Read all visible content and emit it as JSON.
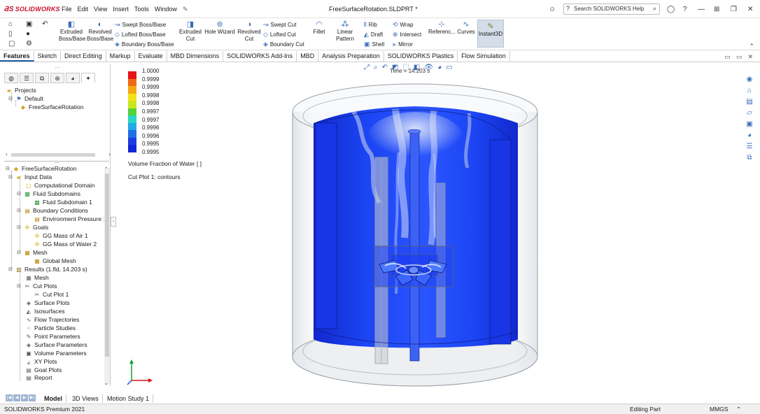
{
  "app": {
    "brand": "SOLIDWORKS",
    "document_title": "FreeSurfaceRotation.SLDPRT *",
    "search_placeholder": "Search SOLIDWORKS Help"
  },
  "menu": [
    "File",
    "Edit",
    "View",
    "Insert",
    "Tools",
    "Window"
  ],
  "commands": {
    "extruded_boss": [
      "Extruded",
      "Boss/Base"
    ],
    "revolved_boss": [
      "Revolved",
      "Boss/Base"
    ],
    "swept_boss": "Swept Boss/Base",
    "lofted_boss": "Lofted Boss/Base",
    "boundary_boss": "Boundary Boss/Base",
    "extruded_cut": [
      "Extruded",
      "Cut"
    ],
    "hole_wizard": "Hole Wizard",
    "revolved_cut": [
      "Revolved",
      "Cut"
    ],
    "swept_cut": "Swept Cut",
    "lofted_cut": "Lofted Cut",
    "boundary_cut": "Boundary Cut",
    "fillet": "Fillet",
    "linear_pattern": "Linear Pattern",
    "rib": "Rib",
    "draft": "Draft",
    "shell": "Shell",
    "wrap": "Wrap",
    "intersect": "Intersect",
    "mirror": "Mirror",
    "reference": "Referenc...",
    "curves": "Curves",
    "instant3d": "Instant3D"
  },
  "tabs": [
    "Features",
    "Sketch",
    "Direct Editing",
    "Markup",
    "Evaluate",
    "MBD Dimensions",
    "SOLIDWORKS Add-Ins",
    "MBD",
    "Analysis Preparation",
    "SOLIDWORKS Plastics",
    "Flow Simulation"
  ],
  "active_tab": "Features",
  "top_tree": {
    "projects": "Projects",
    "default": "Default",
    "part": "FreeSurfaceRotation"
  },
  "analysis_tree": {
    "root": "FreeSurfaceRotation",
    "input_data": "Input Data",
    "computational_domain": "Computational Domain",
    "fluid_subdomains": "Fluid Subdomains",
    "fluid_subdomain_1": "Fluid Subdomain 1",
    "boundary_conditions": "Boundary Conditions",
    "environment_pressure": "Environment Pressure 1",
    "goals": "Goals",
    "goal_air": "GG Mass of Air 1",
    "goal_water": "GG Mass of Water 2",
    "mesh": "Mesh",
    "global_mesh": "Global Mesh",
    "results": "Results (1.fld, 14.203 s)",
    "results_mesh": "Mesh",
    "cut_plots": "Cut Plots",
    "cut_plot_1": "Cut Plot 1",
    "surface_plots": "Surface Plots",
    "isosurfaces": "Isosurfaces",
    "flow_trajectories": "Flow Trajectories",
    "particle_studies": "Particle Studies",
    "point_parameters": "Point Parameters",
    "surface_parameters": "Surface Parameters",
    "volume_parameters": "Volume Parameters",
    "xy_plots": "XY Plots",
    "goal_plots": "Goal Plots",
    "report": "Report"
  },
  "legend": {
    "values": [
      "1.0000",
      "0.9999",
      "0.9999",
      "0.9998",
      "0.9998",
      "0.9997",
      "0.9997",
      "0.9996",
      "0.9996",
      "0.9995",
      "0.9995"
    ],
    "colors": [
      "#e8121a",
      "#ef6a15",
      "#f5a812",
      "#f3e21a",
      "#c8e81c",
      "#54d23a",
      "#2ad6c4",
      "#23a8e8",
      "#1f6fe6",
      "#1c3ee0",
      "#1226d6"
    ],
    "title": "Volume Fraction of Water [ ]",
    "plot_label": "Cut Plot 1: contours"
  },
  "time_label": "Time = 14.203 s",
  "bottom_tabs": [
    "Model",
    "3D Views",
    "Motion Study 1"
  ],
  "active_bottom_tab": "Model",
  "status": {
    "product": "SOLIDWORKS Premium 2021",
    "mode": "Editing Part",
    "units": "MMGS"
  },
  "colors": {
    "water": "#1a3cf0",
    "accent": "#1f5fa8"
  }
}
